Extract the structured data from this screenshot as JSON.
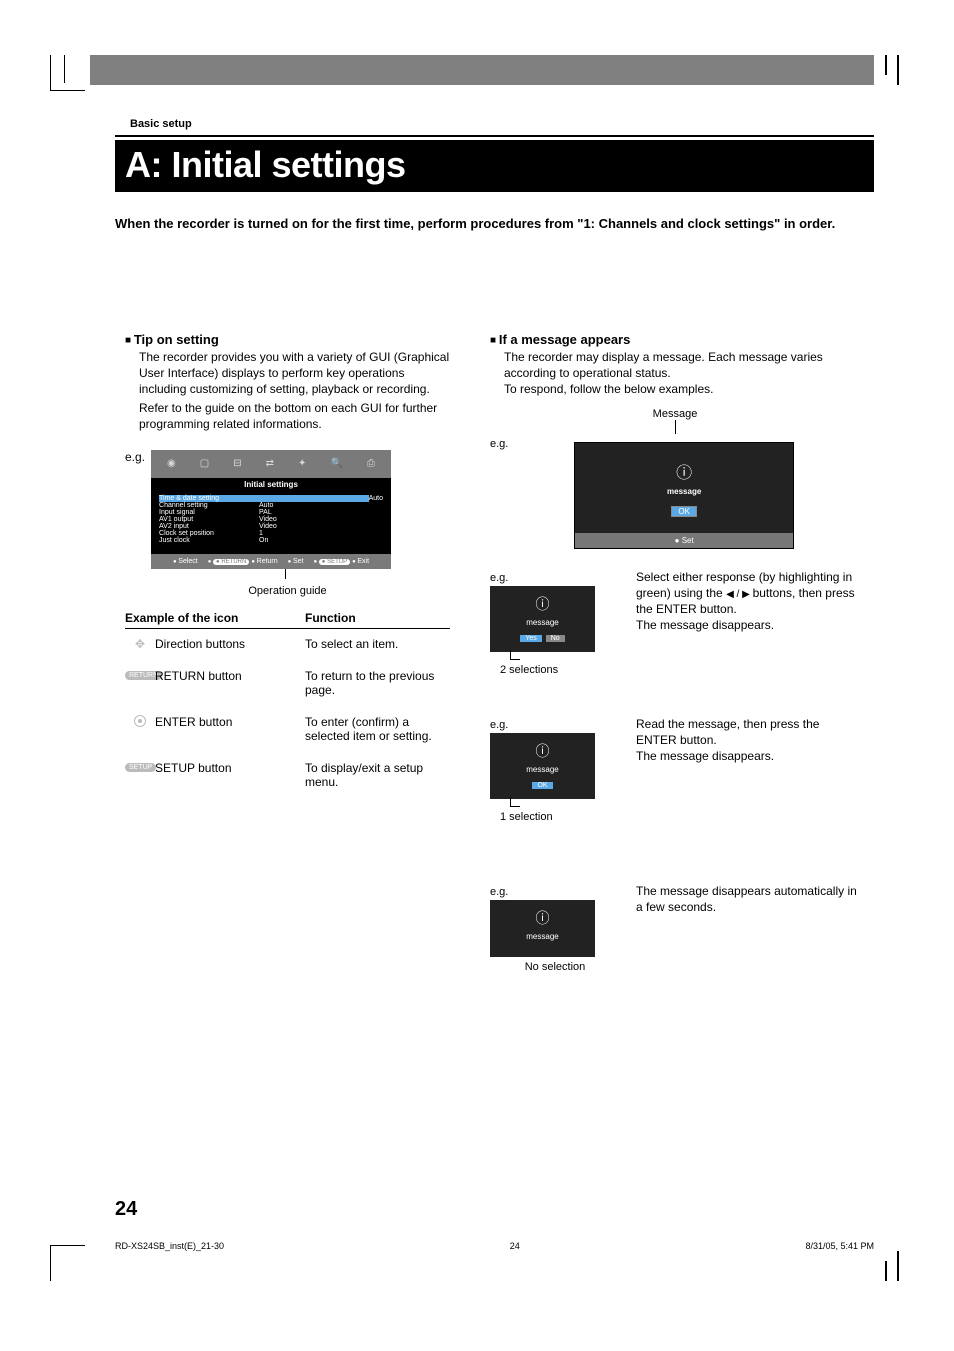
{
  "section_label": "Basic setup",
  "title": "A: Initial settings",
  "intro": "When the recorder is turned on for the first time, perform procedures from \"1: Channels and clock settings\" in order.",
  "left": {
    "tip_heading": "Tip on setting",
    "tip_p1": "The recorder provides you with a variety of GUI (Graphical User Interface) displays to perform key operations including customizing of setting, playback or recording.",
    "tip_p2": "Refer to the guide on the bottom on each GUI for further programming related informations.",
    "eg": "e.g.",
    "osd": {
      "title": "Initial settings",
      "rows": [
        {
          "k": "Time & date setting",
          "v": "Auto"
        },
        {
          "k": "Channel setting",
          "v": "Auto"
        },
        {
          "k": "Input signal",
          "v": "PAL"
        },
        {
          "k": "AV1 output",
          "v": "Video"
        },
        {
          "k": "AV2 input",
          "v": "Video"
        },
        {
          "k": "Clock set position",
          "v": "1"
        },
        {
          "k": "Just clock",
          "v": "On"
        }
      ],
      "foot": {
        "select": "Select",
        "return": "Return",
        "set": "Set",
        "exit": "Exit",
        "return_pill": "RETURN",
        "setup_pill": "SETUP"
      }
    },
    "operation_guide": "Operation guide",
    "table": {
      "h1": "Example of the icon",
      "h2": "Function",
      "rows": [
        {
          "icon_name": "direction-icon",
          "name": "Direction buttons",
          "fn": "To select an item."
        },
        {
          "icon_name": "return-icon",
          "pill": "RETURN",
          "name": "RETURN button",
          "fn": "To return to the previous page."
        },
        {
          "icon_name": "enter-icon",
          "name": "ENTER button",
          "fn": "To enter (confirm) a selected item or setting."
        },
        {
          "icon_name": "setup-icon",
          "pill": "SETUP",
          "name": "SETUP button",
          "fn": "To display/exit a setup menu."
        }
      ]
    }
  },
  "right": {
    "heading": "If a message appears",
    "p1": "The recorder may display a message. Each message varies according to operational status.",
    "p2": "To respond, follow the below examples.",
    "message_label": "Message",
    "eg": "e.g.",
    "msg_text": "message",
    "ok": "OK",
    "set": "Set",
    "yes": "Yes",
    "no": "No",
    "ex2": {
      "text1": "Select either response (by highlighting in green) using the",
      "text2": "buttons, then press the ENTER button.",
      "text3": "The message disappears.",
      "caption": "2 selections"
    },
    "ex3": {
      "text1": "Read the message, then press the ENTER button.",
      "text2": "The message disappears.",
      "caption": "1 selection"
    },
    "ex4": {
      "text1": "The message disappears automatically in a few seconds.",
      "caption": "No selection"
    }
  },
  "page_number": "24",
  "footer": {
    "left": "RD-XS24SB_inst(E)_21-30",
    "center": "24",
    "right": "8/31/05, 5:41 PM"
  }
}
